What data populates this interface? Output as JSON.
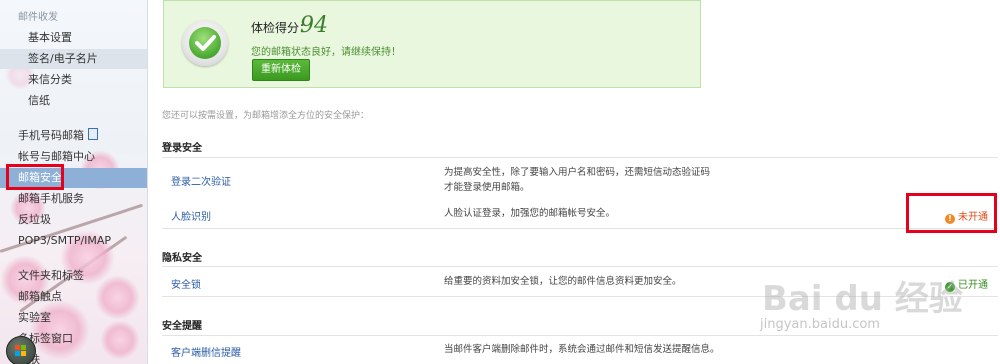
{
  "sidebar": {
    "group_mail_settings": "邮件收发",
    "basic_settings": "基本设置",
    "signature": "签名/电子名片",
    "incoming_category": "来信分类",
    "stationery": "信纸",
    "phone_mailbox": "手机号码邮箱",
    "account_center": "帐号与邮箱中心",
    "mailbox_security": "邮箱安全",
    "mobile_service": "邮箱手机服务",
    "spam": "反垃圾",
    "pop3": "POP3/SMTP/IMAP",
    "folders_tags": "文件夹和标签",
    "mail_touch": "邮箱触点",
    "lab": "实验室",
    "multi_tab": "多标签窗口",
    "skin": "换肤"
  },
  "score": {
    "label": "体检得分：",
    "value": "94",
    "message": "您的邮箱状态良好，请继续保持！",
    "recheck_button": "重新体检"
  },
  "hint": "您还可以按需设置，为邮箱增添全方位的安全保护：",
  "sections": {
    "login": {
      "title": "登录安全",
      "two_step": {
        "label": "登录二次验证",
        "desc": "为提高安全性，除了要输入用户名和密码，还需短信动态验证码才能登录使用邮箱。"
      },
      "face": {
        "label": "人脸识别",
        "desc": "人脸认证登录，加强您的邮箱帐号安全。",
        "status": "未开通"
      }
    },
    "privacy": {
      "title": "隐私安全",
      "lock": {
        "label": "安全锁",
        "desc": "给重要的资料加安全锁，让您的邮件信息资料更加安全。",
        "status": "已开通"
      }
    },
    "alert": {
      "title": "安全提醒",
      "client_delete": {
        "label": "客户端删信提醒",
        "desc": "当邮件客户端删除邮件时，系统会通过邮件和短信发送提醒信息。"
      }
    }
  },
  "watermark": {
    "logo": "Bai du 经验",
    "url": "jingyan.baidu.com"
  },
  "colors": {
    "accent_green": "#3a9a1f",
    "link_blue": "#2a5ca8",
    "status_off": "#e04a1a",
    "highlight_red": "#e5001b"
  }
}
